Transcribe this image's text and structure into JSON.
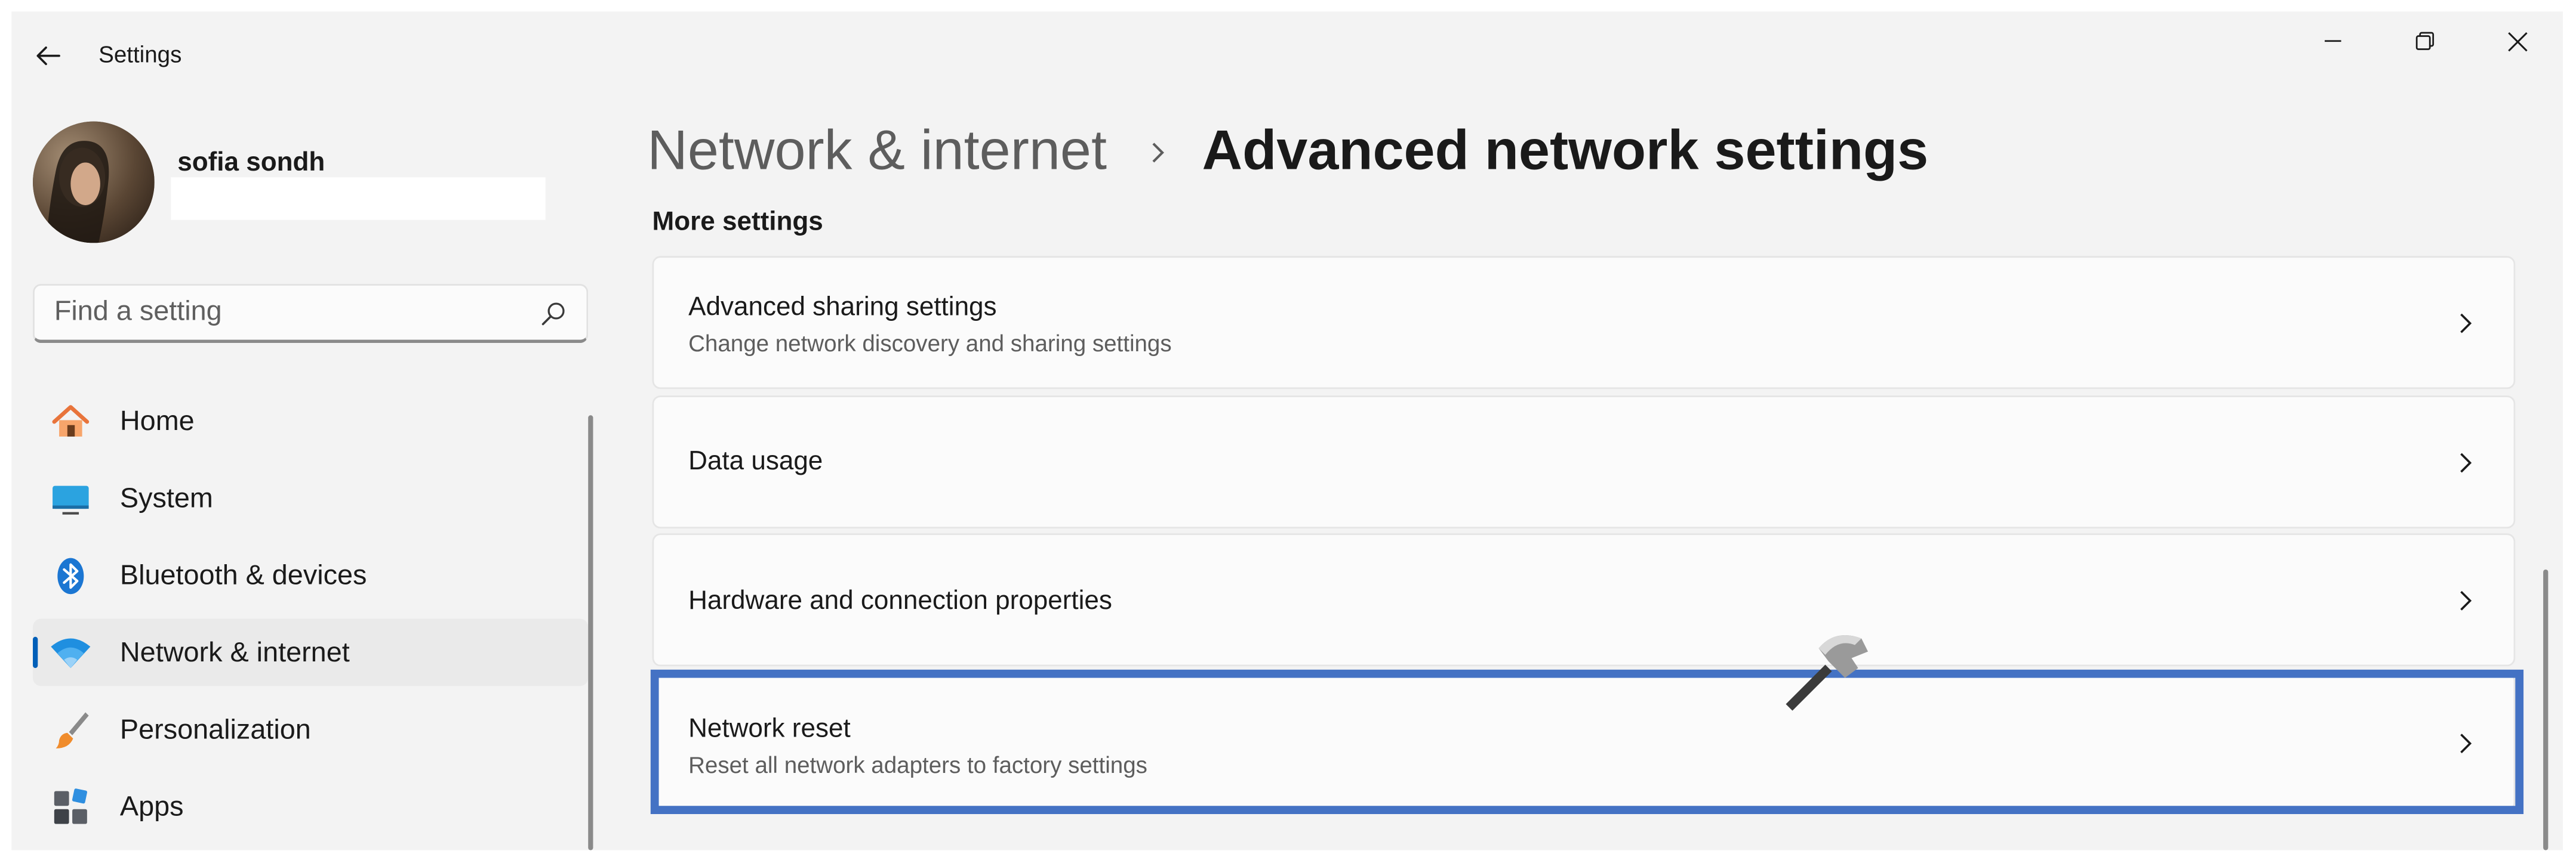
{
  "window": {
    "app_title": "Settings",
    "minimize_label": "Minimize",
    "maximize_label": "Restore",
    "close_label": "Close"
  },
  "account": {
    "name": "sofia sondh",
    "email": ""
  },
  "search": {
    "placeholder": "Find a setting",
    "value": ""
  },
  "sidebar": {
    "items": [
      {
        "label": "Home",
        "icon": "home-icon",
        "selected": false
      },
      {
        "label": "System",
        "icon": "monitor-icon",
        "selected": false
      },
      {
        "label": "Bluetooth & devices",
        "icon": "bluetooth-icon",
        "selected": false
      },
      {
        "label": "Network & internet",
        "icon": "wifi-icon",
        "selected": true
      },
      {
        "label": "Personalization",
        "icon": "paintbrush-icon",
        "selected": false
      },
      {
        "label": "Apps",
        "icon": "apps-icon",
        "selected": false
      }
    ]
  },
  "header": {
    "parent": "Network & internet",
    "current": "Advanced network settings"
  },
  "section": {
    "title": "More settings",
    "cards": [
      {
        "title": "Advanced sharing settings",
        "description": "Change network discovery and sharing settings"
      },
      {
        "title": "Data usage",
        "description": ""
      },
      {
        "title": "Hardware and connection properties",
        "description": ""
      },
      {
        "title": "Network reset",
        "description": "Reset all network adapters to factory settings"
      }
    ]
  },
  "colors": {
    "accent": "#005fb8",
    "highlight_border": "#4472c4",
    "window_bg": "#f3f3f3",
    "card_bg": "#fbfbfb"
  }
}
